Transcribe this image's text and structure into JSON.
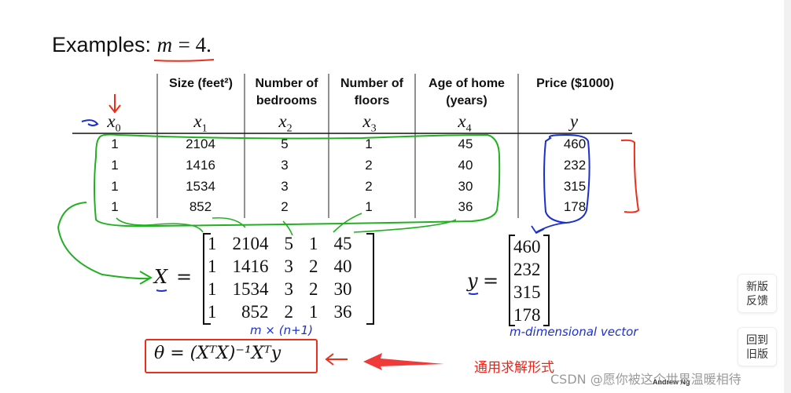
{
  "title": {
    "prefix": "Examples:",
    "math_var": "m",
    "math_rest": "= 4."
  },
  "table": {
    "headers": [
      {
        "label": "",
        "var": "x",
        "sub": "0"
      },
      {
        "label": "Size (feet²)",
        "var": "x",
        "sub": "1"
      },
      {
        "label": "Number of bedrooms",
        "var": "x",
        "sub": "2"
      },
      {
        "label": "Number of floors",
        "var": "x",
        "sub": "3"
      },
      {
        "label": "Age of home (years)",
        "var": "x",
        "sub": "4"
      },
      {
        "label": "Price ($1000)",
        "var": "y",
        "sub": ""
      }
    ],
    "header_lines": [
      [
        "",
        ""
      ],
      [
        "Size (feet²)",
        ""
      ],
      [
        "Number of",
        "bedrooms"
      ],
      [
        "Number of",
        "floors"
      ],
      [
        "Age of home",
        "(years)"
      ],
      [
        "Price ($1000)",
        ""
      ]
    ],
    "rows": [
      [
        "1",
        "2104",
        "5",
        "1",
        "45",
        "460"
      ],
      [
        "1",
        "1416",
        "3",
        "2",
        "40",
        "232"
      ],
      [
        "1",
        "1534",
        "3",
        "2",
        "30",
        "315"
      ],
      [
        "1",
        "852",
        "2",
        "1",
        "36",
        "178"
      ]
    ]
  },
  "matrix_X": {
    "label": "X",
    "equals": "=",
    "rows": [
      [
        "1",
        "2104",
        "5",
        "1",
        "45"
      ],
      [
        "1",
        "1416",
        "3",
        "2",
        "40"
      ],
      [
        "1",
        "1534",
        "3",
        "2",
        "30"
      ],
      [
        "1",
        "852",
        "2",
        "1",
        "36"
      ]
    ],
    "annotation": "m × (n+1)"
  },
  "vector_y": {
    "label": "y",
    "equals": "=",
    "values": [
      "460",
      "232",
      "315",
      "178"
    ],
    "annotation": "m-dimensional vector"
  },
  "formula": {
    "text": "θ = (XᵀX)⁻¹Xᵀy"
  },
  "annotation_cn": "通用求解形式",
  "footer": {
    "credit": "Andrew Ng",
    "watermark": "CSDN @愿你被这个世界温暖相待"
  },
  "side_buttons": [
    {
      "line1": "新版",
      "line2": "反馈"
    },
    {
      "line1": "回到",
      "line2": "旧版"
    }
  ],
  "colors": {
    "green_ink": "#22b022",
    "blue_ink": "#1a2fd0",
    "red_ink": "#e8301c",
    "red_arrow": "#f03a3a",
    "annotation_red": "#e8261c"
  }
}
